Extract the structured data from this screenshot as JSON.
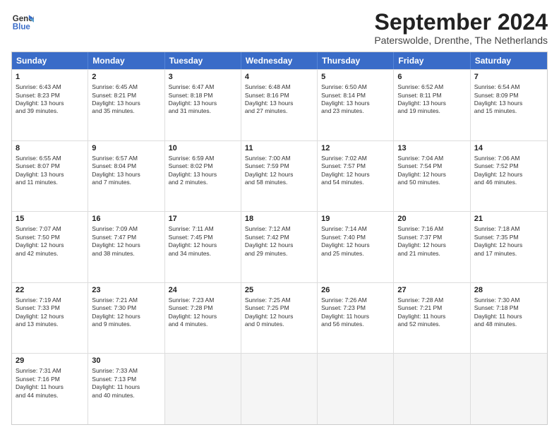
{
  "header": {
    "logo_line1": "General",
    "logo_line2": "Blue",
    "title": "September 2024",
    "location": "Paterswolde, Drenthe, The Netherlands"
  },
  "days_of_week": [
    "Sunday",
    "Monday",
    "Tuesday",
    "Wednesday",
    "Thursday",
    "Friday",
    "Saturday"
  ],
  "weeks": [
    [
      {
        "day": "1",
        "lines": [
          "Sunrise: 6:43 AM",
          "Sunset: 8:23 PM",
          "Daylight: 13 hours",
          "and 39 minutes."
        ]
      },
      {
        "day": "2",
        "lines": [
          "Sunrise: 6:45 AM",
          "Sunset: 8:21 PM",
          "Daylight: 13 hours",
          "and 35 minutes."
        ]
      },
      {
        "day": "3",
        "lines": [
          "Sunrise: 6:47 AM",
          "Sunset: 8:18 PM",
          "Daylight: 13 hours",
          "and 31 minutes."
        ]
      },
      {
        "day": "4",
        "lines": [
          "Sunrise: 6:48 AM",
          "Sunset: 8:16 PM",
          "Daylight: 13 hours",
          "and 27 minutes."
        ]
      },
      {
        "day": "5",
        "lines": [
          "Sunrise: 6:50 AM",
          "Sunset: 8:14 PM",
          "Daylight: 13 hours",
          "and 23 minutes."
        ]
      },
      {
        "day": "6",
        "lines": [
          "Sunrise: 6:52 AM",
          "Sunset: 8:11 PM",
          "Daylight: 13 hours",
          "and 19 minutes."
        ]
      },
      {
        "day": "7",
        "lines": [
          "Sunrise: 6:54 AM",
          "Sunset: 8:09 PM",
          "Daylight: 13 hours",
          "and 15 minutes."
        ]
      }
    ],
    [
      {
        "day": "8",
        "lines": [
          "Sunrise: 6:55 AM",
          "Sunset: 8:07 PM",
          "Daylight: 13 hours",
          "and 11 minutes."
        ]
      },
      {
        "day": "9",
        "lines": [
          "Sunrise: 6:57 AM",
          "Sunset: 8:04 PM",
          "Daylight: 13 hours",
          "and 7 minutes."
        ]
      },
      {
        "day": "10",
        "lines": [
          "Sunrise: 6:59 AM",
          "Sunset: 8:02 PM",
          "Daylight: 13 hours",
          "and 2 minutes."
        ]
      },
      {
        "day": "11",
        "lines": [
          "Sunrise: 7:00 AM",
          "Sunset: 7:59 PM",
          "Daylight: 12 hours",
          "and 58 minutes."
        ]
      },
      {
        "day": "12",
        "lines": [
          "Sunrise: 7:02 AM",
          "Sunset: 7:57 PM",
          "Daylight: 12 hours",
          "and 54 minutes."
        ]
      },
      {
        "day": "13",
        "lines": [
          "Sunrise: 7:04 AM",
          "Sunset: 7:54 PM",
          "Daylight: 12 hours",
          "and 50 minutes."
        ]
      },
      {
        "day": "14",
        "lines": [
          "Sunrise: 7:06 AM",
          "Sunset: 7:52 PM",
          "Daylight: 12 hours",
          "and 46 minutes."
        ]
      }
    ],
    [
      {
        "day": "15",
        "lines": [
          "Sunrise: 7:07 AM",
          "Sunset: 7:50 PM",
          "Daylight: 12 hours",
          "and 42 minutes."
        ]
      },
      {
        "day": "16",
        "lines": [
          "Sunrise: 7:09 AM",
          "Sunset: 7:47 PM",
          "Daylight: 12 hours",
          "and 38 minutes."
        ]
      },
      {
        "day": "17",
        "lines": [
          "Sunrise: 7:11 AM",
          "Sunset: 7:45 PM",
          "Daylight: 12 hours",
          "and 34 minutes."
        ]
      },
      {
        "day": "18",
        "lines": [
          "Sunrise: 7:12 AM",
          "Sunset: 7:42 PM",
          "Daylight: 12 hours",
          "and 29 minutes."
        ]
      },
      {
        "day": "19",
        "lines": [
          "Sunrise: 7:14 AM",
          "Sunset: 7:40 PM",
          "Daylight: 12 hours",
          "and 25 minutes."
        ]
      },
      {
        "day": "20",
        "lines": [
          "Sunrise: 7:16 AM",
          "Sunset: 7:37 PM",
          "Daylight: 12 hours",
          "and 21 minutes."
        ]
      },
      {
        "day": "21",
        "lines": [
          "Sunrise: 7:18 AM",
          "Sunset: 7:35 PM",
          "Daylight: 12 hours",
          "and 17 minutes."
        ]
      }
    ],
    [
      {
        "day": "22",
        "lines": [
          "Sunrise: 7:19 AM",
          "Sunset: 7:33 PM",
          "Daylight: 12 hours",
          "and 13 minutes."
        ]
      },
      {
        "day": "23",
        "lines": [
          "Sunrise: 7:21 AM",
          "Sunset: 7:30 PM",
          "Daylight: 12 hours",
          "and 9 minutes."
        ]
      },
      {
        "day": "24",
        "lines": [
          "Sunrise: 7:23 AM",
          "Sunset: 7:28 PM",
          "Daylight: 12 hours",
          "and 4 minutes."
        ]
      },
      {
        "day": "25",
        "lines": [
          "Sunrise: 7:25 AM",
          "Sunset: 7:25 PM",
          "Daylight: 12 hours",
          "and 0 minutes."
        ]
      },
      {
        "day": "26",
        "lines": [
          "Sunrise: 7:26 AM",
          "Sunset: 7:23 PM",
          "Daylight: 11 hours",
          "and 56 minutes."
        ]
      },
      {
        "day": "27",
        "lines": [
          "Sunrise: 7:28 AM",
          "Sunset: 7:21 PM",
          "Daylight: 11 hours",
          "and 52 minutes."
        ]
      },
      {
        "day": "28",
        "lines": [
          "Sunrise: 7:30 AM",
          "Sunset: 7:18 PM",
          "Daylight: 11 hours",
          "and 48 minutes."
        ]
      }
    ],
    [
      {
        "day": "29",
        "lines": [
          "Sunrise: 7:31 AM",
          "Sunset: 7:16 PM",
          "Daylight: 11 hours",
          "and 44 minutes."
        ]
      },
      {
        "day": "30",
        "lines": [
          "Sunrise: 7:33 AM",
          "Sunset: 7:13 PM",
          "Daylight: 11 hours",
          "and 40 minutes."
        ]
      },
      {
        "day": "",
        "lines": [],
        "empty": true
      },
      {
        "day": "",
        "lines": [],
        "empty": true
      },
      {
        "day": "",
        "lines": [],
        "empty": true
      },
      {
        "day": "",
        "lines": [],
        "empty": true
      },
      {
        "day": "",
        "lines": [],
        "empty": true
      }
    ]
  ]
}
